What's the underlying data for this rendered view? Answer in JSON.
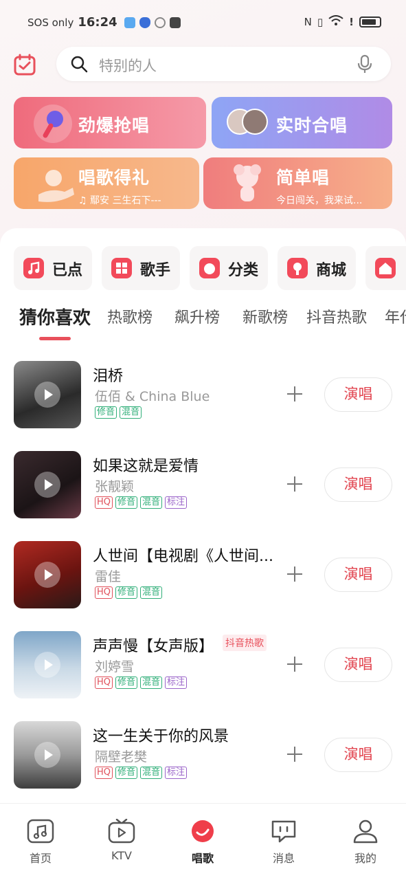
{
  "status_bar": {
    "carrier": "SOS only",
    "time": "16:24",
    "wifi": "6"
  },
  "search": {
    "placeholder": "特别的人"
  },
  "promos": [
    {
      "title": "劲爆抢唱",
      "sub": ""
    },
    {
      "title": "实时合唱",
      "sub": ""
    },
    {
      "title": "唱歌得礼",
      "sub": "♫ 鄢安    三生石下---"
    },
    {
      "title": "简单唱",
      "sub": "今日闯关，我来试..."
    }
  ],
  "quick": [
    {
      "label": "已点",
      "icon": "music-note-icon"
    },
    {
      "label": "歌手",
      "icon": "grid-icon"
    },
    {
      "label": "分类",
      "icon": "category-icon"
    },
    {
      "label": "商城",
      "icon": "shop-icon"
    },
    {
      "label": "",
      "icon": "home-icon"
    }
  ],
  "tabs": [
    "猜你喜欢",
    "热歌榜",
    "飙升榜",
    "新歌榜",
    "抖音热歌",
    "年代"
  ],
  "songs": [
    {
      "title": "泪桥",
      "artist": "伍佰 & China Blue",
      "badge": "",
      "tags": [
        "修音",
        "混音"
      ],
      "action": "演唱"
    },
    {
      "title": "如果这就是爱情",
      "artist": "张靓颖",
      "badge": "",
      "tags": [
        "HQ",
        "修音",
        "混音",
        "标注"
      ],
      "action": "演唱"
    },
    {
      "title": "人世间【电视剧《人世间...",
      "artist": "雷佳",
      "badge": "",
      "tags": [
        "HQ",
        "修音",
        "混音"
      ],
      "action": "演唱"
    },
    {
      "title": "声声慢【女声版】",
      "artist": "刘婷雪",
      "badge": "抖音热歌",
      "tags": [
        "HQ",
        "修音",
        "混音",
        "标注"
      ],
      "action": "演唱"
    },
    {
      "title": "这一生关于你的风景",
      "artist": "隔壁老樊",
      "badge": "",
      "tags": [
        "HQ",
        "修音",
        "混音",
        "标注"
      ],
      "action": "演唱"
    }
  ],
  "nav": [
    {
      "label": "首页"
    },
    {
      "label": "KTV"
    },
    {
      "label": "唱歌"
    },
    {
      "label": "消息"
    },
    {
      "label": "我的"
    }
  ],
  "colors": {
    "accent": "#e8505b",
    "tag_hq": "#e0505a",
    "tag_green": "#2fae78",
    "tag_purple": "#9a63c9"
  }
}
